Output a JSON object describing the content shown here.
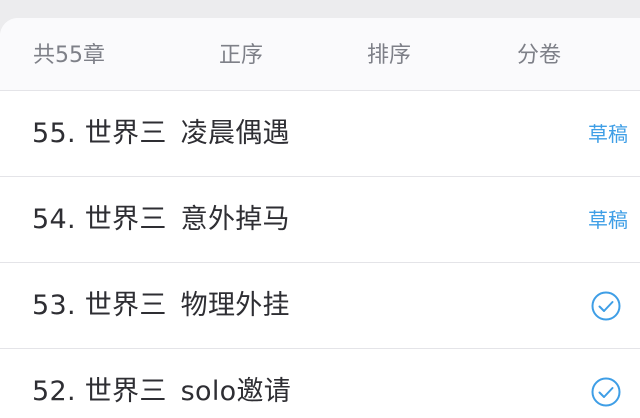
{
  "tabs": {
    "count_label": "共55章",
    "order_label": "正序",
    "sort_label": "排序",
    "volume_label": "分卷"
  },
  "chapters": [
    {
      "number": "55.",
      "world": "世界三",
      "name": "凌晨偶遇",
      "status": "草稿",
      "status_type": "draft"
    },
    {
      "number": "54.",
      "world": "世界三",
      "name": "意外掉马",
      "status": "草稿",
      "status_type": "draft"
    },
    {
      "number": "53.",
      "world": "世界三",
      "name": "物理外挂",
      "status_icon": "check-circle-icon",
      "status_type": "published"
    },
    {
      "number": "52.",
      "world": "世界三",
      "name": "solo邀请",
      "status_icon": "check-circle-icon",
      "status_type": "published"
    }
  ],
  "colors": {
    "accent": "#3e9ee6",
    "text_primary": "#2e2e33",
    "text_secondary": "#7e8088"
  }
}
